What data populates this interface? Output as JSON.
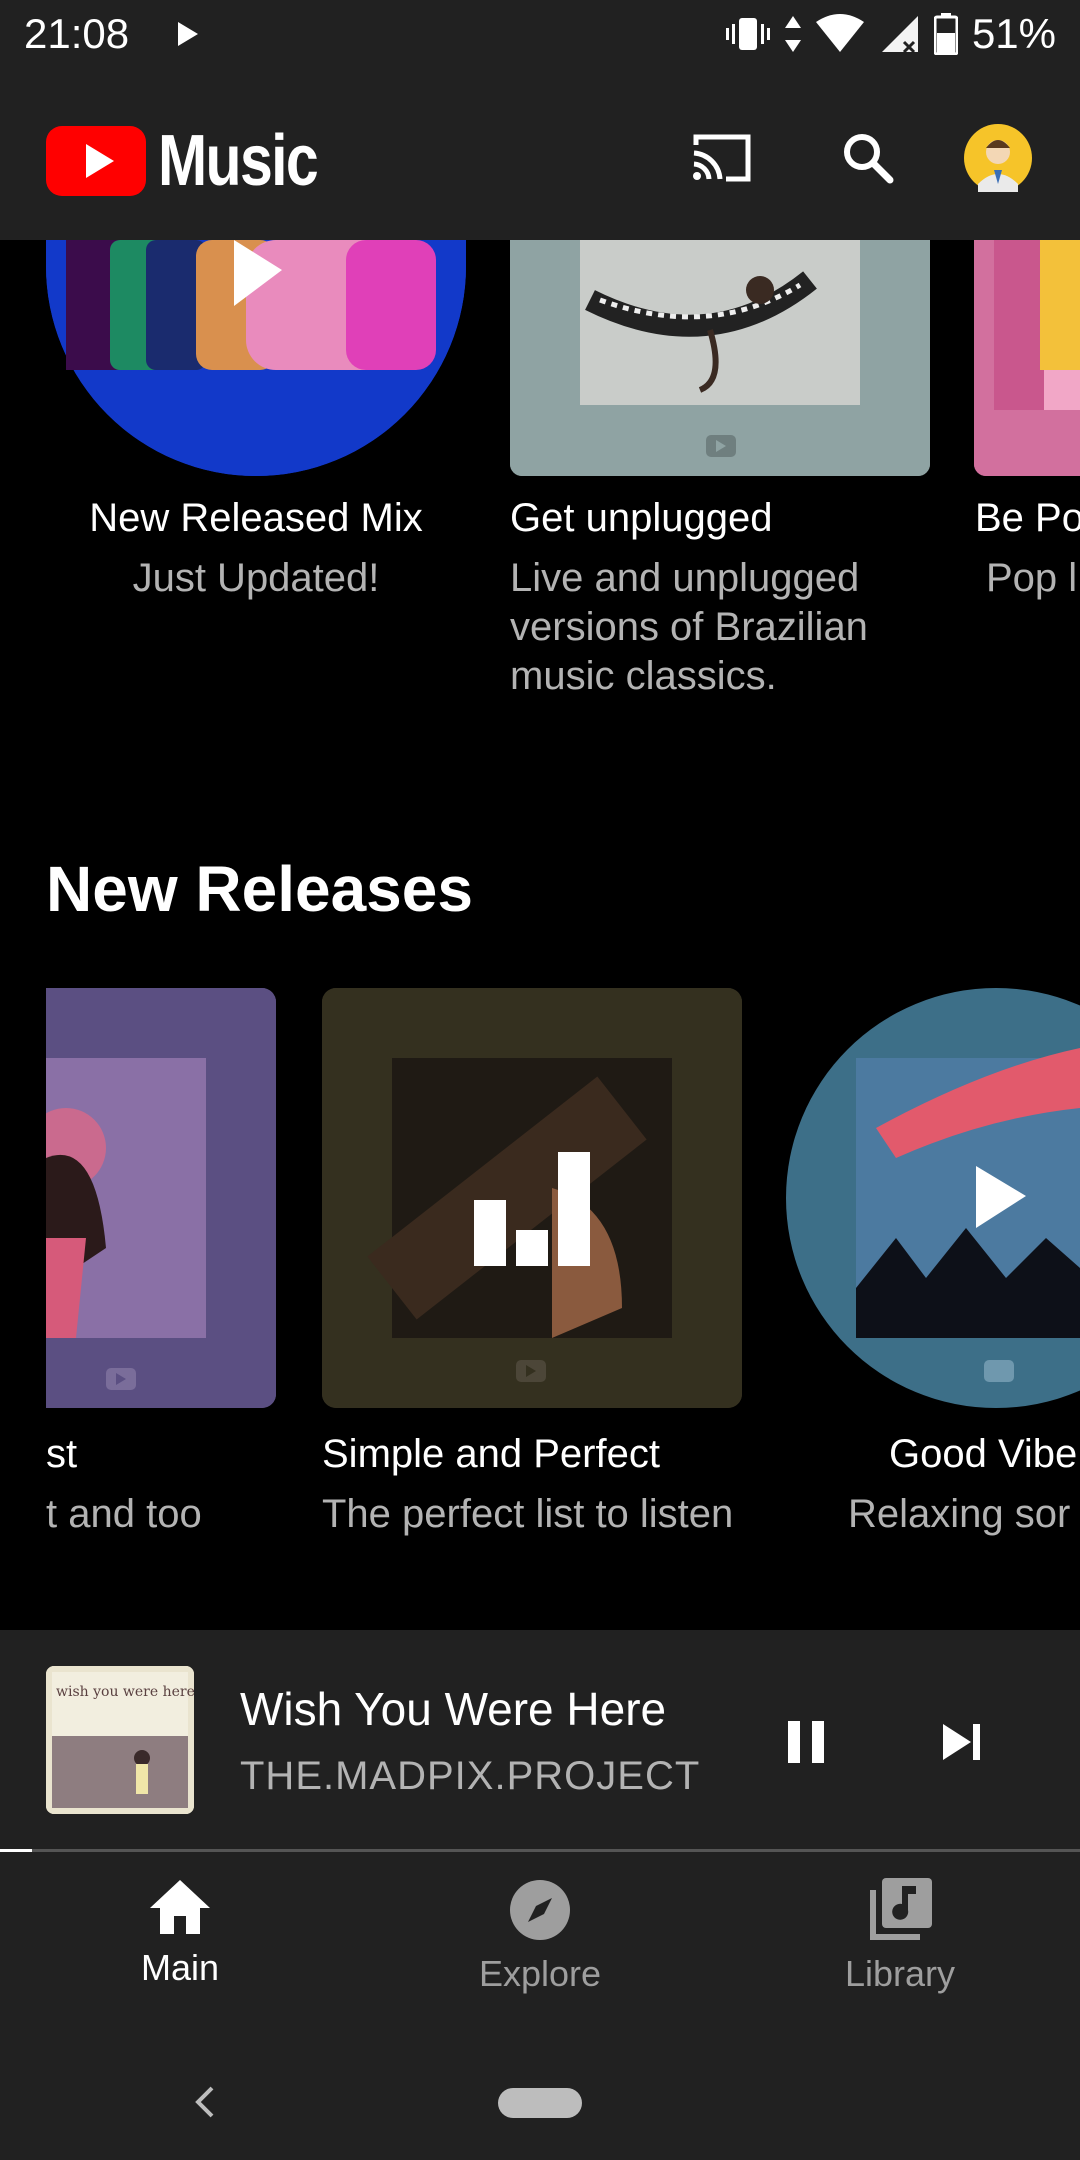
{
  "status_bar": {
    "time": "21:08",
    "battery": "51%"
  },
  "app": {
    "title": "Music"
  },
  "top_row": [
    {
      "title": "New Released Mix",
      "subtitle": "Just Updated!"
    },
    {
      "title": "Get unplugged",
      "subtitle": "Live and unplugged versions of Brazilian music classics."
    },
    {
      "title": "Be Po",
      "subtitle": "Pop l"
    }
  ],
  "new_releases": {
    "heading": "New Releases",
    "items": [
      {
        "title": "st",
        "subtitle": "t and too"
      },
      {
        "title": "Simple and Perfect",
        "subtitle": "The perfect list to listen"
      },
      {
        "title": "Good Vibe",
        "subtitle": "Relaxing sor"
      }
    ]
  },
  "now_playing": {
    "song": "Wish You Were Here",
    "artist": "THE.MADPIX.PROJECT",
    "thumb_text": "wish you were here",
    "progress": 0.03
  },
  "bottom_nav": [
    {
      "label": "Main",
      "active": true
    },
    {
      "label": "Explore",
      "active": false
    },
    {
      "label": "Library",
      "active": false
    }
  ],
  "colors": {
    "accent_red": "#ff0000",
    "bar_bg": "#212121",
    "inactive": "#9e9e9e"
  }
}
